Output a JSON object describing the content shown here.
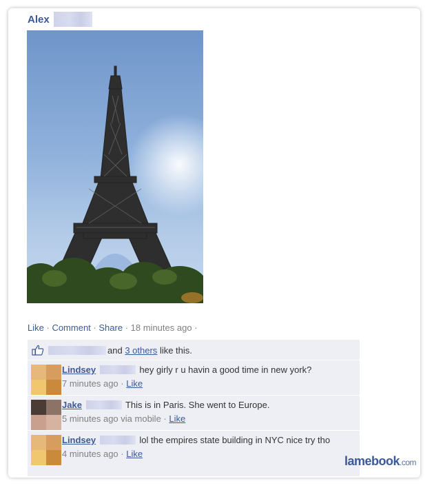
{
  "post": {
    "author": "Alex",
    "actions": {
      "like": "Like",
      "comment": "Comment",
      "share": "Share",
      "timestamp": "18 minutes ago"
    }
  },
  "likes": {
    "and_text": "and",
    "others": "3 others",
    "suffix": "like this."
  },
  "comments": [
    {
      "name": "Lindsey",
      "text": "hey girly r u havin a good time in new york?",
      "time": "7 minutes ago",
      "via": "",
      "like": "Like"
    },
    {
      "name": "Jake",
      "text": "This is in Paris. She went to Europe.",
      "time": "5 minutes ago via mobile",
      "via": "",
      "like": "Like"
    },
    {
      "name": "Lindsey",
      "text": "lol the empires state building in NYC nice try tho",
      "time": "4 minutes ago",
      "via": "",
      "like": "Like"
    }
  ],
  "watermark": {
    "brand": "lamebook",
    "tld": ".com"
  },
  "colors": {
    "link": "#3b5998",
    "meta_gray": "#808080",
    "feedback_bg": "#edeff4"
  }
}
